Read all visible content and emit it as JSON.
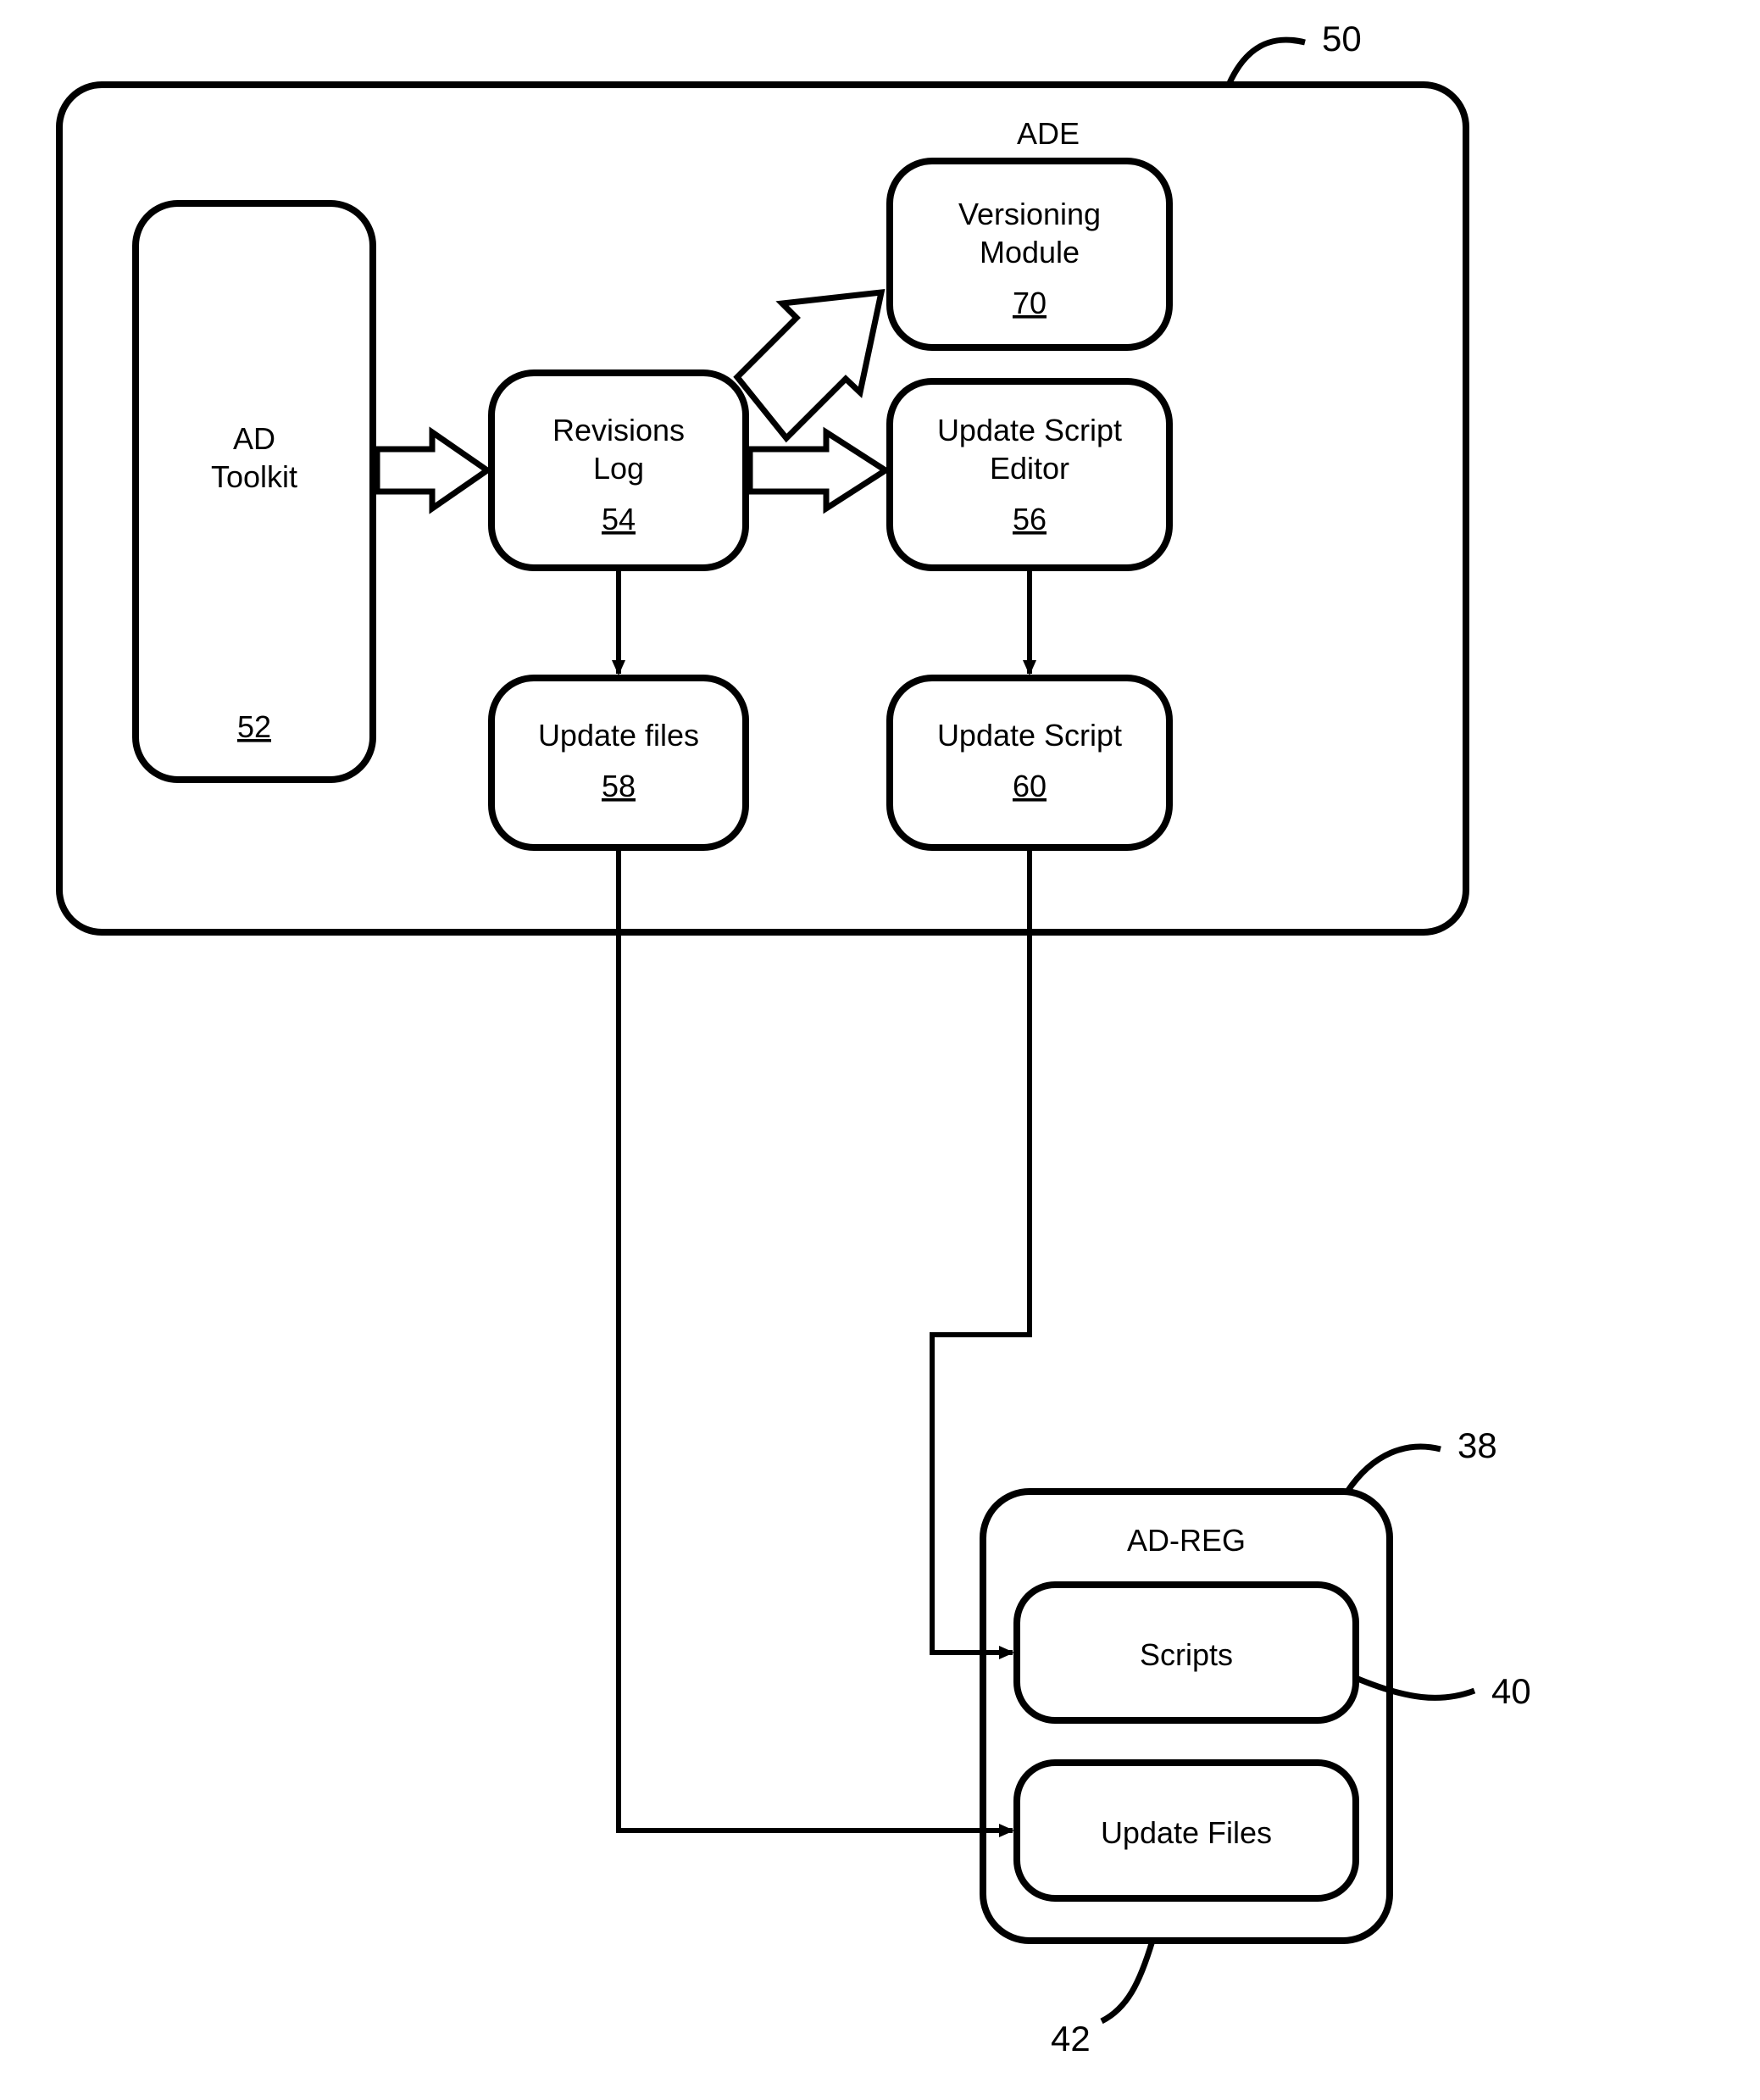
{
  "diagram": {
    "ade": {
      "title": "ADE",
      "ref": "50",
      "nodes": {
        "toolkit": {
          "line1": "AD",
          "line2": "Toolkit",
          "ref": "52"
        },
        "revisions": {
          "line1": "Revisions",
          "line2": "Log",
          "ref": "54"
        },
        "versioning": {
          "line1": "Versioning",
          "line2": "Module",
          "ref": "70"
        },
        "editor": {
          "line1": "Update Script",
          "line2": "Editor",
          "ref": "56"
        },
        "ufiles": {
          "line1": "Update files",
          "ref": "58"
        },
        "uscript": {
          "line1": "Update Script",
          "ref": "60"
        }
      }
    },
    "adreg": {
      "title": "AD-REG",
      "ref": "38",
      "nodes": {
        "scripts": {
          "label": "Scripts",
          "ref": "40"
        },
        "updfiles": {
          "label": "Update Files",
          "ref": "42"
        }
      }
    }
  }
}
